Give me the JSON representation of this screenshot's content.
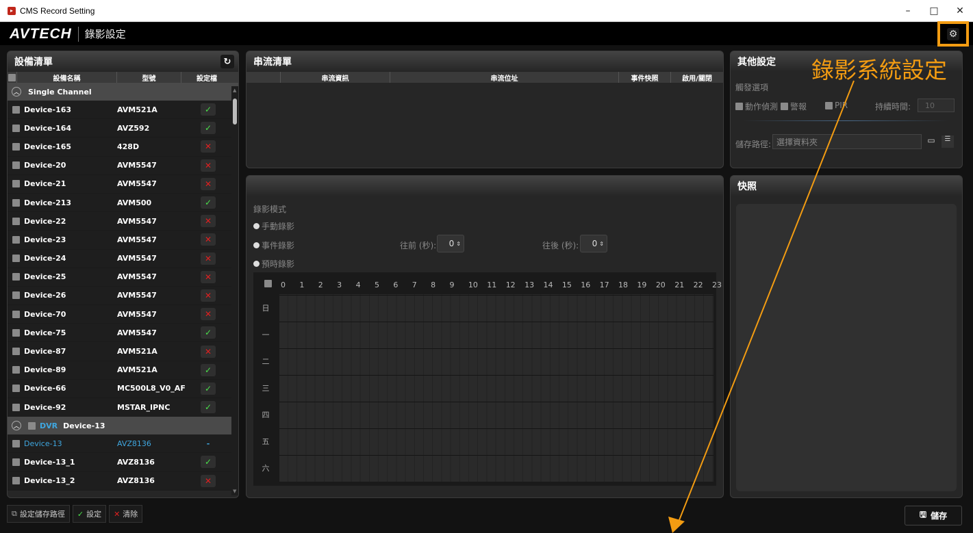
{
  "window": {
    "title": "CMS Record Setting",
    "minimize": "–",
    "maximize": "□",
    "close": "✕"
  },
  "header": {
    "logo": "AVTECH",
    "title": "錄影設定"
  },
  "device_list": {
    "title": "設備清單",
    "columns": [
      "設備名稱",
      "型號",
      "設定檔"
    ],
    "group1": "Single Channel",
    "rows": [
      {
        "name": "Device-163",
        "model": "AVM521A",
        "ok": true
      },
      {
        "name": "Device-164",
        "model": "AVZ592",
        "ok": true
      },
      {
        "name": "Device-165",
        "model": "428D",
        "ok": false
      },
      {
        "name": "Device-20",
        "model": "AVM5547",
        "ok": false
      },
      {
        "name": "Device-21",
        "model": "AVM5547",
        "ok": false
      },
      {
        "name": "Device-213",
        "model": "AVM500",
        "ok": true
      },
      {
        "name": "Device-22",
        "model": "AVM5547",
        "ok": false
      },
      {
        "name": "Device-23",
        "model": "AVM5547",
        "ok": false
      },
      {
        "name": "Device-24",
        "model": "AVM5547",
        "ok": false
      },
      {
        "name": "Device-25",
        "model": "AVM5547",
        "ok": false
      },
      {
        "name": "Device-26",
        "model": "AVM5547",
        "ok": false
      },
      {
        "name": "Device-70",
        "model": "AVM5547",
        "ok": false
      },
      {
        "name": "Device-75",
        "model": "AVM5547",
        "ok": true
      },
      {
        "name": "Device-87",
        "model": "AVM521A",
        "ok": false
      },
      {
        "name": "Device-89",
        "model": "AVM521A",
        "ok": true
      },
      {
        "name": "Device-66",
        "model": "MC500L8_V0_AF",
        "ok": true
      },
      {
        "name": "Device-92",
        "model": "MSTAR_IPNC",
        "ok": true
      }
    ],
    "group2_tag": "DVR",
    "group2_name": "Device-13",
    "rows2": [
      {
        "name": "Device-13",
        "model": "AVZ8136",
        "status": "-"
      },
      {
        "name": "Device-13_1",
        "model": "AVZ8136",
        "ok": true
      },
      {
        "name": "Device-13_2",
        "model": "AVZ8136",
        "ok": false
      }
    ]
  },
  "stream_list": {
    "title": "串流清單",
    "columns": [
      "串流資訊",
      "串流位址",
      "事件快照",
      "啟用/關閉"
    ]
  },
  "record": {
    "mode_label": "錄影模式",
    "manual": "手動錄影",
    "event": "事件錄影",
    "schedule": "預時錄影",
    "before_label": "往前 (秒):",
    "before_value": "0",
    "after_label": "往後 (秒):",
    "after_value": "0",
    "hours": [
      "0",
      "1",
      "2",
      "3",
      "4",
      "5",
      "6",
      "7",
      "8",
      "9",
      "10",
      "11",
      "12",
      "13",
      "14",
      "15",
      "16",
      "17",
      "18",
      "19",
      "20",
      "21",
      "22",
      "23"
    ],
    "days": [
      "日",
      "一",
      "二",
      "三",
      "四",
      "五",
      "六"
    ]
  },
  "other": {
    "title": "其他設定",
    "trigger_label": "觸發選項",
    "motion": "動作偵測",
    "alarm": "警報",
    "pir": "PIR",
    "duration_label": "持續時間:",
    "duration_value": "10",
    "path_label": "儲存路徑:",
    "path_placeholder": "選擇資料夾"
  },
  "snapshot": {
    "title": "快照"
  },
  "bottom": {
    "set_path": "設定儲存路徑",
    "apply": "設定",
    "clear": "清除",
    "save": "儲存"
  },
  "annotation": {
    "text": "錄影系統設定",
    "color": "#f39c12"
  }
}
